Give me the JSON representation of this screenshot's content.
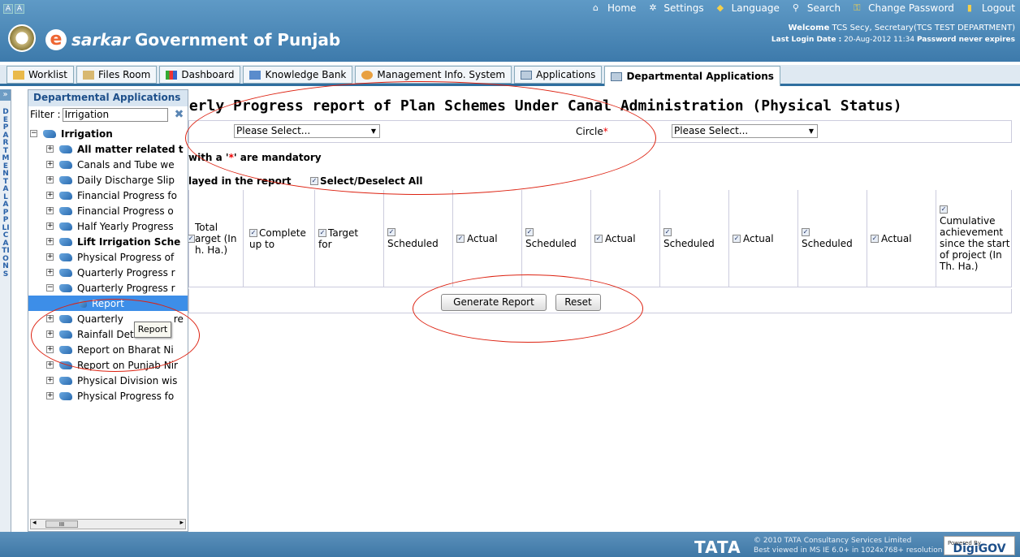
{
  "header": {
    "az": [
      "A",
      "A"
    ],
    "links": [
      {
        "label": "Home",
        "icon": "home-icon",
        "glyph": "⌂"
      },
      {
        "label": "Settings",
        "icon": "gear-icon",
        "glyph": "✲"
      },
      {
        "label": "Language",
        "icon": "language-icon",
        "glyph": "◆"
      },
      {
        "label": "Search",
        "icon": "search-icon",
        "glyph": "⚲"
      },
      {
        "label": "Change Password",
        "icon": "key-icon",
        "glyph": "⚿"
      },
      {
        "label": "Logout",
        "icon": "logout-icon",
        "glyph": "▮"
      }
    ],
    "brand_e": "e",
    "brand_sarkar": "sarkar",
    "brand_gov": "Government of Punjab",
    "welcome_label": "Welcome",
    "welcome_user": " TCS Secy, Secretary(TCS TEST DEPARTMENT)",
    "login_label": "Last Login Date :",
    "login_date": " 20-Aug-2012 11:34 ",
    "pwd_expires": "Password never expires"
  },
  "tabs": [
    "Worklist",
    "Files Room",
    "Dashboard",
    "Knowledge Bank",
    "Management Info. System",
    "Applications",
    "Departmental Applications"
  ],
  "side_strip": {
    "toggle": "»",
    "vertical_text": "DEPARTMENTAL APPLICATIONS"
  },
  "panel": {
    "title": "Departmental Applications",
    "filter_label": "Filter :",
    "filter_value": "Irrigation",
    "clear": "✖",
    "root": "Irrigation",
    "items": [
      {
        "label": "All matter related t",
        "bold": true
      },
      {
        "label": "Canals and Tube we",
        "bold": false
      },
      {
        "label": "Daily Discharge Slip",
        "bold": false
      },
      {
        "label": "Financial Progress fo",
        "bold": false
      },
      {
        "label": "Financial Progress o",
        "bold": false
      },
      {
        "label": "Half Yearly Progress",
        "bold": false
      },
      {
        "label": "Lift Irrigation Sche",
        "bold": true
      },
      {
        "label": "Physical Progress of",
        "bold": false
      },
      {
        "label": "Quarterly Progress r",
        "bold": false
      },
      {
        "label": "Quarterly Progress r",
        "bold": false,
        "expanded": true
      },
      {
        "label": "Report",
        "bold": false,
        "leaf": true,
        "selected": true
      },
      {
        "label": "Quarterly",
        "suffix": "re",
        "bold": false
      },
      {
        "label": "Rainfall Details",
        "bold": false
      },
      {
        "label": "Report on Bharat Ni",
        "bold": false
      },
      {
        "label": "Report on Punjab Nir",
        "bold": false
      },
      {
        "label": "Physical Division wis",
        "bold": false
      },
      {
        "label": "Physical Progress fo",
        "bold": false
      }
    ],
    "tooltip": "Report",
    "scroll_thumb": "III",
    "scroll_left": "◂",
    "scroll_right": "▸"
  },
  "main": {
    "title": "terly Progress report of Plan Schemes Under Canal Administration (Physical Status)",
    "select1": "Please Select...",
    "circle_label": "Circle",
    "required": "*",
    "select2": "Please Select...",
    "mandatory_pre": "with a '",
    "mandatory_star": "*",
    "mandatory_post": "' are mandatory",
    "displayed": "layed in the report",
    "select_all": "Select/Deselect All",
    "columns": [
      "Total Target (In Th. Ha.)",
      "Complete up to",
      "Target for",
      "Scheduled",
      "Actual",
      "Scheduled",
      "Actual",
      "Scheduled",
      "Actual",
      "Scheduled",
      "Actual",
      "Cumulative achievement since the start of project (In Th. Ha.)"
    ],
    "col0_lines": [
      "Total",
      "arget (In",
      "h. Ha.)"
    ],
    "generate": "Generate Report",
    "reset": "Reset"
  },
  "footer": {
    "tata": "TATA",
    "copyright": "© 2010 TATA Consultancy Services Limited",
    "best_viewed": "Best viewed in MS IE 6.0+ in 1024x768+ resolution",
    "powered_by": "Powered By",
    "digigov": "DigiGOV"
  },
  "colors": {
    "accent": "#3d7aab",
    "tab_border": "#2f6e9f",
    "annotation": "#d21"
  }
}
